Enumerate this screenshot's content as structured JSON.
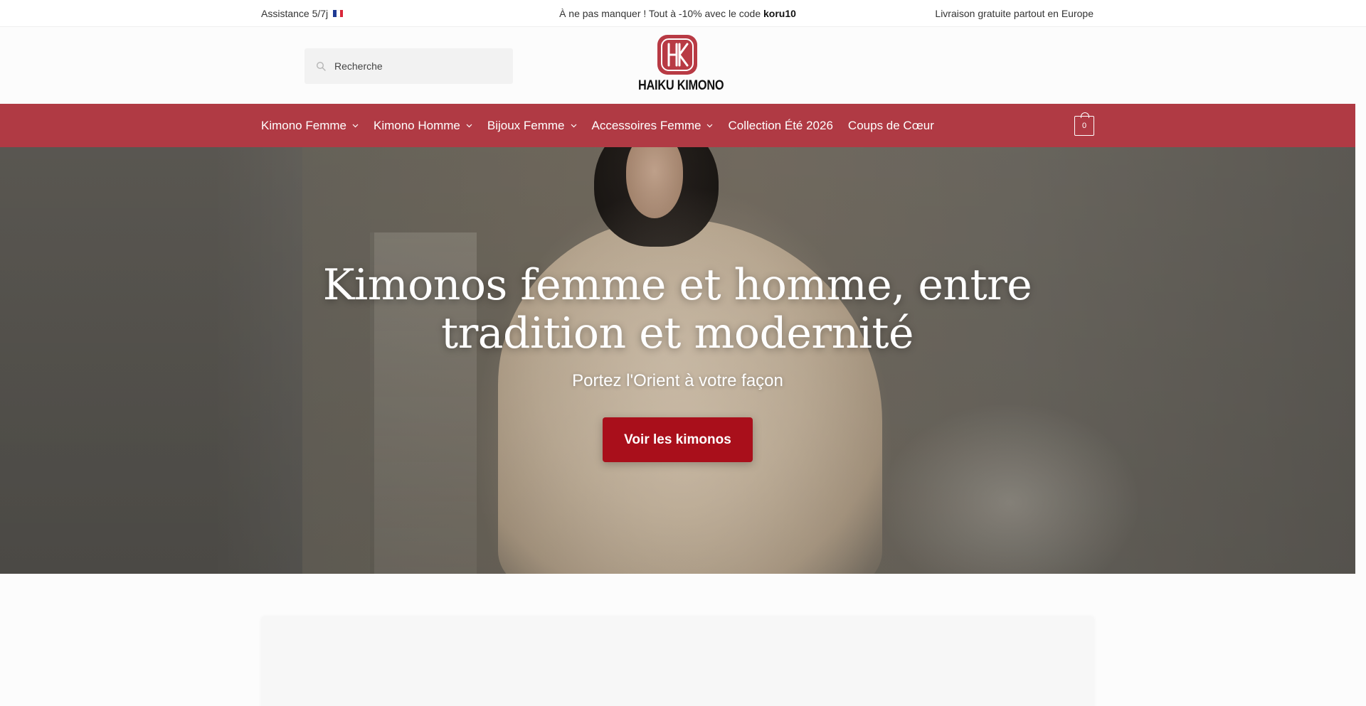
{
  "topbar": {
    "assistance": "Assistance 5/7j",
    "promo_prefix": "À ne pas manquer ! Tout à -10% avec le code ",
    "promo_code": "koru10",
    "shipping": "Livraison gratuite partout en Europe"
  },
  "header": {
    "search_placeholder": "Recherche",
    "logo_monogram": "HK",
    "brand_name": "HAIKU KIMONO"
  },
  "nav": {
    "items": [
      {
        "label": "Kimono Femme",
        "has_dropdown": true
      },
      {
        "label": "Kimono Homme",
        "has_dropdown": true
      },
      {
        "label": "Bijoux Femme",
        "has_dropdown": true
      },
      {
        "label": "Accessoires Femme",
        "has_dropdown": true
      },
      {
        "label": "Collection Été 2026",
        "has_dropdown": false
      },
      {
        "label": "Coups de Cœur",
        "has_dropdown": false
      }
    ],
    "cart_count": "0"
  },
  "hero": {
    "title": "Kimonos femme et homme, entre tradition et modernité",
    "subtitle": "Portez l'Orient à votre façon",
    "cta_label": "Voir les kimonos"
  },
  "colors": {
    "nav_background": "#b03a44",
    "cta_background": "#a90f1b",
    "logo_red": "#b83a44"
  },
  "icons": {
    "search": "search-icon",
    "flag": "france-flag-icon",
    "chevron": "chevron-down-icon",
    "cart": "cart-icon"
  }
}
